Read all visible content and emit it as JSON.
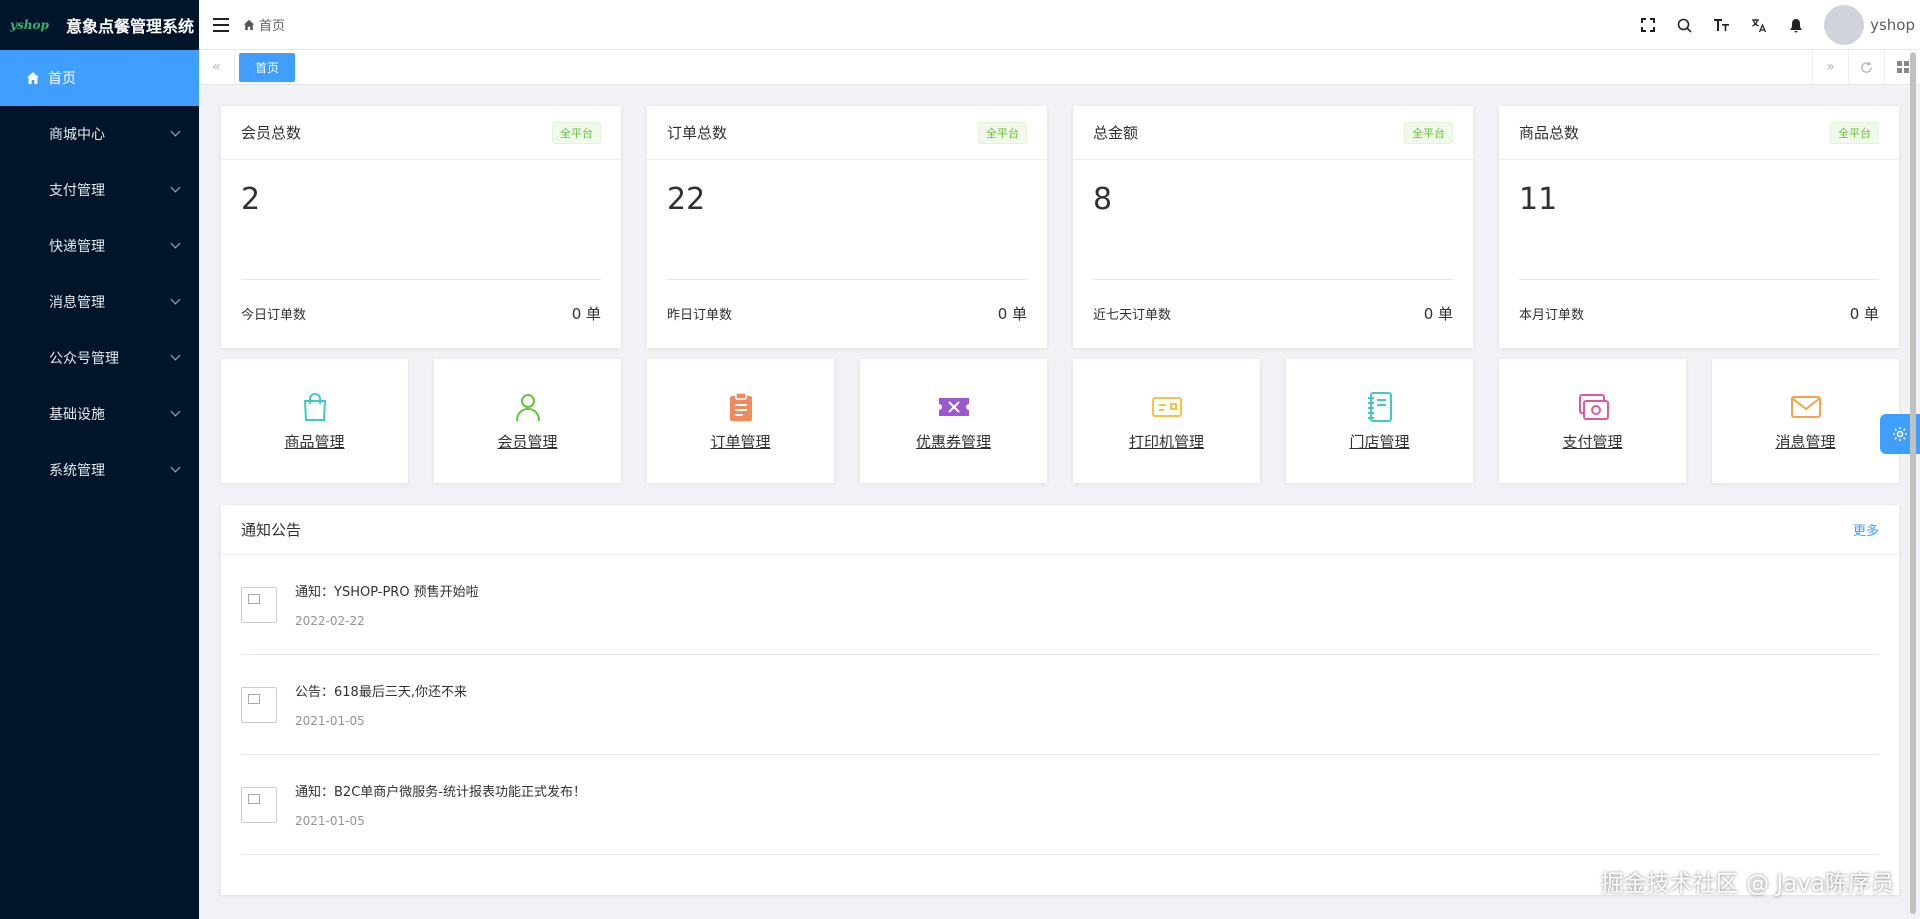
{
  "brand": {
    "logo": "yshop",
    "title": "意象点餐管理系统"
  },
  "sidebar": {
    "items": [
      {
        "label": "首页",
        "active": true
      },
      {
        "label": "商城中心"
      },
      {
        "label": "支付管理"
      },
      {
        "label": "快递管理"
      },
      {
        "label": "消息管理"
      },
      {
        "label": "公众号管理"
      },
      {
        "label": "基础设施"
      },
      {
        "label": "系统管理"
      }
    ]
  },
  "navbar": {
    "breadcrumb": "首页",
    "username": "yshop",
    "icons": [
      "fullscreen-icon",
      "search-icon",
      "font-size-icon",
      "translate-icon",
      "bell-icon"
    ]
  },
  "tagsview": {
    "tags": [
      "首页"
    ]
  },
  "stats": [
    {
      "title": "会员总数",
      "badge": "全平台",
      "value": "2",
      "foot_label": "今日订单数",
      "foot_value": "0 单"
    },
    {
      "title": "订单总数",
      "badge": "全平台",
      "value": "22",
      "foot_label": "昨日订单数",
      "foot_value": "0 单"
    },
    {
      "title": "总金额",
      "badge": "全平台",
      "value": "8",
      "foot_label": "近七天订单数",
      "foot_value": "0 单"
    },
    {
      "title": "商品总数",
      "badge": "全平台",
      "value": "11",
      "foot_label": "本月订单数",
      "foot_value": "0 单"
    }
  ],
  "quick": [
    {
      "label": "商品管理",
      "icon": "shopping-bag-icon",
      "color": "#40c9c6"
    },
    {
      "label": "会员管理",
      "icon": "user-icon",
      "color": "#67c23a"
    },
    {
      "label": "订单管理",
      "icon": "clipboard-icon",
      "color": "#f4516c"
    },
    {
      "label": "优惠券管理",
      "icon": "ticket-icon",
      "color": "#9b59d0"
    },
    {
      "label": "打印机管理",
      "icon": "printer-icon",
      "color": "#f6c343"
    },
    {
      "label": "门店管理",
      "icon": "notebook-icon",
      "color": "#36a3f7"
    },
    {
      "label": "支付管理",
      "icon": "payment-icon",
      "color": "#e05a9b"
    },
    {
      "label": "消息管理",
      "icon": "mail-icon",
      "color": "#f0a44b"
    }
  ],
  "notice": {
    "title": "通知公告",
    "more": "更多",
    "items": [
      {
        "title": "通知：YSHOP-PRO 预售开始啦",
        "date": "2022-02-22"
      },
      {
        "title": "公告：618最后三天,你还不来",
        "date": "2021-01-05"
      },
      {
        "title": "通知：B2C单商户微服务-统计报表功能正式发布！",
        "date": "2021-01-05"
      }
    ]
  },
  "watermark": "掘金技术社区 @ Java陈序员"
}
